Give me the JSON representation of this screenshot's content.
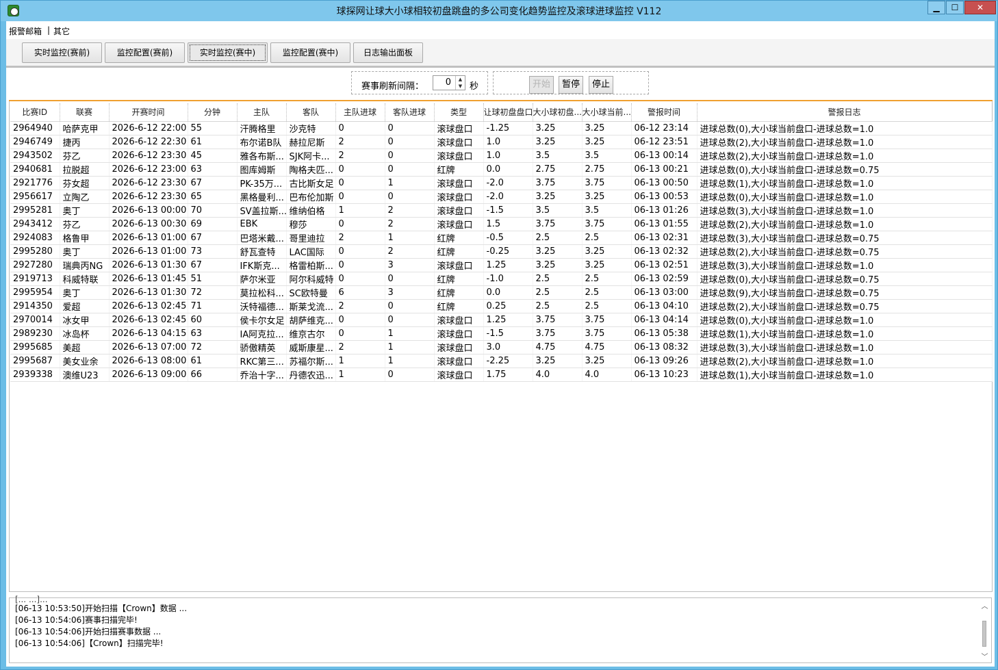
{
  "window": {
    "title": "球探网让球大小球相较初盘跳盘的多公司变化趋势监控及滚球进球监控 V112",
    "minimize": "▁",
    "maximize": "☐",
    "close": "✕"
  },
  "menu": [
    {
      "label": "报警邮箱"
    },
    {
      "label": "其它"
    }
  ],
  "menu_separator": "|",
  "tabs": [
    {
      "label": "实时监控(赛前)"
    },
    {
      "label": "监控配置(赛前)"
    },
    {
      "label": "实时监控(赛中)",
      "active": true
    },
    {
      "label": "监控配置(赛中)"
    },
    {
      "label": "日志输出面板"
    }
  ],
  "controls": {
    "refresh_label": "赛事刷新间隔：",
    "refresh_value": "0",
    "refresh_unit": "秒",
    "start_label": "开始",
    "pause_label": "暂停",
    "stop_label": "停止"
  },
  "table": {
    "headers": [
      "比赛ID",
      "联赛",
      "开赛时间",
      "分钟",
      "主队",
      "客队",
      "主队进球",
      "客队进球",
      "类型",
      "让球初盘盘口",
      "大小球初盘...",
      "大小球当前...",
      "警报时间",
      "警报日志"
    ],
    "rows": [
      [
        "2964940",
        "哈萨克甲",
        "2026-6-12 22:00",
        "55",
        "汗腾格里",
        "沙克特",
        "0",
        "0",
        "滚球盘口",
        "-1.25",
        "3.25",
        "3.25",
        "06-12 23:14",
        "进球总数(0),大小球当前盘口-进球总数=1.0"
      ],
      [
        "2946749",
        "捷丙",
        "2026-6-12 22:30",
        "61",
        "布尔诺B队",
        "赫拉尼斯",
        "2",
        "0",
        "滚球盘口",
        "1.0",
        "3.25",
        "3.25",
        "06-12 23:51",
        "进球总数(2),大小球当前盘口-进球总数=1.0"
      ],
      [
        "2943502",
        "芬乙",
        "2026-6-12 23:30",
        "45",
        "雅各布斯...",
        "SJK阿卡...",
        "2",
        "0",
        "滚球盘口",
        "1.0",
        "3.5",
        "3.5",
        "06-13 00:14",
        "进球总数(2),大小球当前盘口-进球总数=1.0"
      ],
      [
        "2940681",
        "拉脱超",
        "2026-6-12 23:00",
        "63",
        "图库姆斯",
        "陶格夫匹...",
        "0",
        "0",
        "红牌",
        "0.0",
        "2.75",
        "2.75",
        "06-13 00:21",
        "进球总数(0),大小球当前盘口-进球总数=0.75"
      ],
      [
        "2921776",
        "芬女超",
        "2026-6-12 23:30",
        "67",
        "PK-35万...",
        "古比斯女足",
        "0",
        "1",
        "滚球盘口",
        "-2.0",
        "3.75",
        "3.75",
        "06-13 00:50",
        "进球总数(1),大小球当前盘口-进球总数=1.0"
      ],
      [
        "2956617",
        "立陶乙",
        "2026-6-12 23:30",
        "65",
        "黑格曼利...",
        "巴布伦加斯",
        "0",
        "0",
        "滚球盘口",
        "-2.0",
        "3.25",
        "3.25",
        "06-13 00:53",
        "进球总数(0),大小球当前盘口-进球总数=1.0"
      ],
      [
        "2995281",
        "奥丁",
        "2026-6-13 00:00",
        "70",
        "SV盖拉斯...",
        "维纳伯格",
        "1",
        "2",
        "滚球盘口",
        "-1.5",
        "3.5",
        "3.5",
        "06-13 01:26",
        "进球总数(3),大小球当前盘口-进球总数=1.0"
      ],
      [
        "2943412",
        "芬乙",
        "2026-6-13 00:30",
        "69",
        "EBK",
        "穆莎",
        "0",
        "2",
        "滚球盘口",
        "1.5",
        "3.75",
        "3.75",
        "06-13 01:55",
        "进球总数(2),大小球当前盘口-进球总数=1.0"
      ],
      [
        "2924083",
        "格鲁甲",
        "2026-6-13 01:00",
        "67",
        "巴塔米戴...",
        "哥里迪拉",
        "2",
        "1",
        "红牌",
        "-0.5",
        "2.5",
        "2.5",
        "06-13 02:31",
        "进球总数(3),大小球当前盘口-进球总数=0.75"
      ],
      [
        "2995280",
        "奥丁",
        "2026-6-13 01:00",
        "73",
        "舒瓦查特",
        "LAC国际",
        "0",
        "2",
        "红牌",
        "-0.25",
        "3.25",
        "3.25",
        "06-13 02:32",
        "进球总数(2),大小球当前盘口-进球总数=0.75"
      ],
      [
        "2927280",
        "瑞典丙NG",
        "2026-6-13 01:30",
        "67",
        "IFK斯克...",
        "格雷柏斯...",
        "0",
        "3",
        "滚球盘口",
        "1.25",
        "3.25",
        "3.25",
        "06-13 02:51",
        "进球总数(3),大小球当前盘口-进球总数=1.0"
      ],
      [
        "2919713",
        "科威特联",
        "2026-6-13 01:45",
        "51",
        "萨尔米亚",
        "阿尔科威特",
        "0",
        "0",
        "红牌",
        "-1.0",
        "2.5",
        "2.5",
        "06-13 02:59",
        "进球总数(0),大小球当前盘口-进球总数=0.75"
      ],
      [
        "2995954",
        "奥丁",
        "2026-6-13 01:30",
        "72",
        "莫拉松科...",
        "SC欧特曼",
        "6",
        "3",
        "红牌",
        "0.0",
        "2.5",
        "2.5",
        "06-13 03:00",
        "进球总数(9),大小球当前盘口-进球总数=0.75"
      ],
      [
        "2914350",
        "爱超",
        "2026-6-13 02:45",
        "71",
        "沃特福德...",
        "斯莱戈流...",
        "2",
        "0",
        "红牌",
        "0.25",
        "2.5",
        "2.5",
        "06-13 04:10",
        "进球总数(2),大小球当前盘口-进球总数=0.75"
      ],
      [
        "2970014",
        "冰女甲",
        "2026-6-13 02:45",
        "60",
        "侯卡尔女足",
        "胡萨维克...",
        "0",
        "0",
        "滚球盘口",
        "1.25",
        "3.75",
        "3.75",
        "06-13 04:14",
        "进球总数(0),大小球当前盘口-进球总数=1.0"
      ],
      [
        "2989230",
        "冰岛杯",
        "2026-6-13 04:15",
        "63",
        "IA阿克拉...",
        "维京古尔",
        "0",
        "1",
        "滚球盘口",
        "-1.5",
        "3.75",
        "3.75",
        "06-13 05:38",
        "进球总数(1),大小球当前盘口-进球总数=1.0"
      ],
      [
        "2995685",
        "美超",
        "2026-6-13 07:00",
        "72",
        "骄傲精英",
        "威斯康星...",
        "2",
        "1",
        "滚球盘口",
        "3.0",
        "4.75",
        "4.75",
        "06-13 08:32",
        "进球总数(3),大小球当前盘口-进球总数=1.0"
      ],
      [
        "2995687",
        "美女业余",
        "2026-6-13 08:00",
        "61",
        "RKC第三...",
        "苏福尔斯...",
        "1",
        "1",
        "滚球盘口",
        "-2.25",
        "3.25",
        "3.25",
        "06-13 09:26",
        "进球总数(2),大小球当前盘口-进球总数=1.0"
      ],
      [
        "2939338",
        "澳维U23",
        "2026-6-13 09:00",
        "66",
        "乔治十字...",
        "丹德农迅...",
        "1",
        "0",
        "滚球盘口",
        "1.75",
        "4.0",
        "4.0",
        "06-13 10:23",
        "进球总数(1),大小球当前盘口-进球总数=1.0"
      ]
    ]
  },
  "log": {
    "partial_line": "[... ...]...",
    "lines": [
      "[06-13 10:53:50]开始扫描【Crown】数据 ...",
      "[06-13 10:54:06]赛事扫描完毕!",
      "[06-13 10:54:06]开始扫描赛事数据 ...",
      "[06-13 10:54:06]【Crown】扫描完毕!"
    ],
    "scroll_up": "︿",
    "scroll_down": "﹀"
  }
}
